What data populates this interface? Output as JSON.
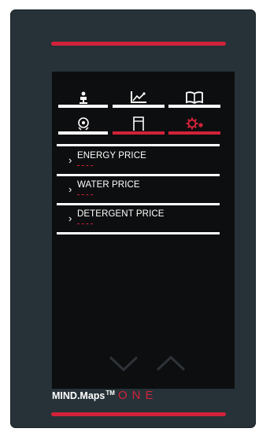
{
  "tabs": [
    {
      "id": "operator",
      "icon": "user-icon",
      "active": false
    },
    {
      "id": "statistics",
      "icon": "line-chart-icon",
      "active": false
    },
    {
      "id": "manual",
      "icon": "book-icon",
      "active": false
    },
    {
      "id": "cycle",
      "icon": "cycle-icon",
      "active": false
    },
    {
      "id": "machine",
      "icon": "machine-icon",
      "active": true
    },
    {
      "id": "settings",
      "icon": "gear-icon",
      "active": true
    }
  ],
  "menu": {
    "items": [
      {
        "label": "ENERGY PRICE"
      },
      {
        "label": "WATER PRICE"
      },
      {
        "label": "DETERGENT PRICE"
      }
    ]
  },
  "nav": {
    "down_icon": "chevron-down-icon",
    "up_icon": "chevron-up-icon"
  },
  "brand": {
    "name": "MIND.Maps",
    "tm": "TM",
    "product": "ONE"
  },
  "colors": {
    "accent": "#d2223a",
    "panel": "#263238",
    "screen": "#0d0e0f",
    "text": "#ffffff"
  }
}
